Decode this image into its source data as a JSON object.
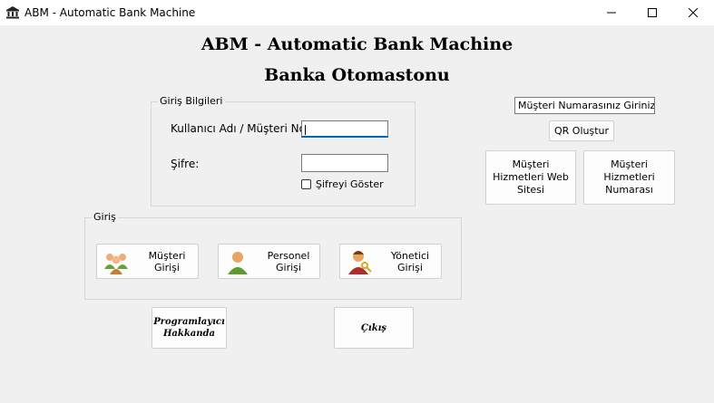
{
  "window": {
    "title": "ABM - Automatic Bank Machine",
    "icon": "bank-icon"
  },
  "header": {
    "title": "ABM - Automatic Bank Machine",
    "subtitle": "Banka Otomastonu"
  },
  "login": {
    "legend": "Giriş Bilgileri",
    "username_label": "Kullanıcı Adı / Müşteri No",
    "username_value": "",
    "password_label": "Şifre:",
    "password_value": "",
    "show_password_label": "Şifreyi Göster",
    "show_password_checked": false
  },
  "entry": {
    "legend": "Giriş",
    "customer_button": "Müşteri Girişi",
    "staff_button": "Personel Girişi",
    "admin_button": "Yönetici Girişi"
  },
  "qr": {
    "input_value": "Müşteri Numarasınız Giriniz",
    "create_button": "QR Oluştur"
  },
  "service": {
    "website_button": "Müşteri Hizmetleri Web Sitesi",
    "phone_button": "Müşteri Hizmetleri Numarası"
  },
  "footer": {
    "about_button": "Programlayıcı Hakkanda",
    "exit_button": "Çıkış"
  }
}
